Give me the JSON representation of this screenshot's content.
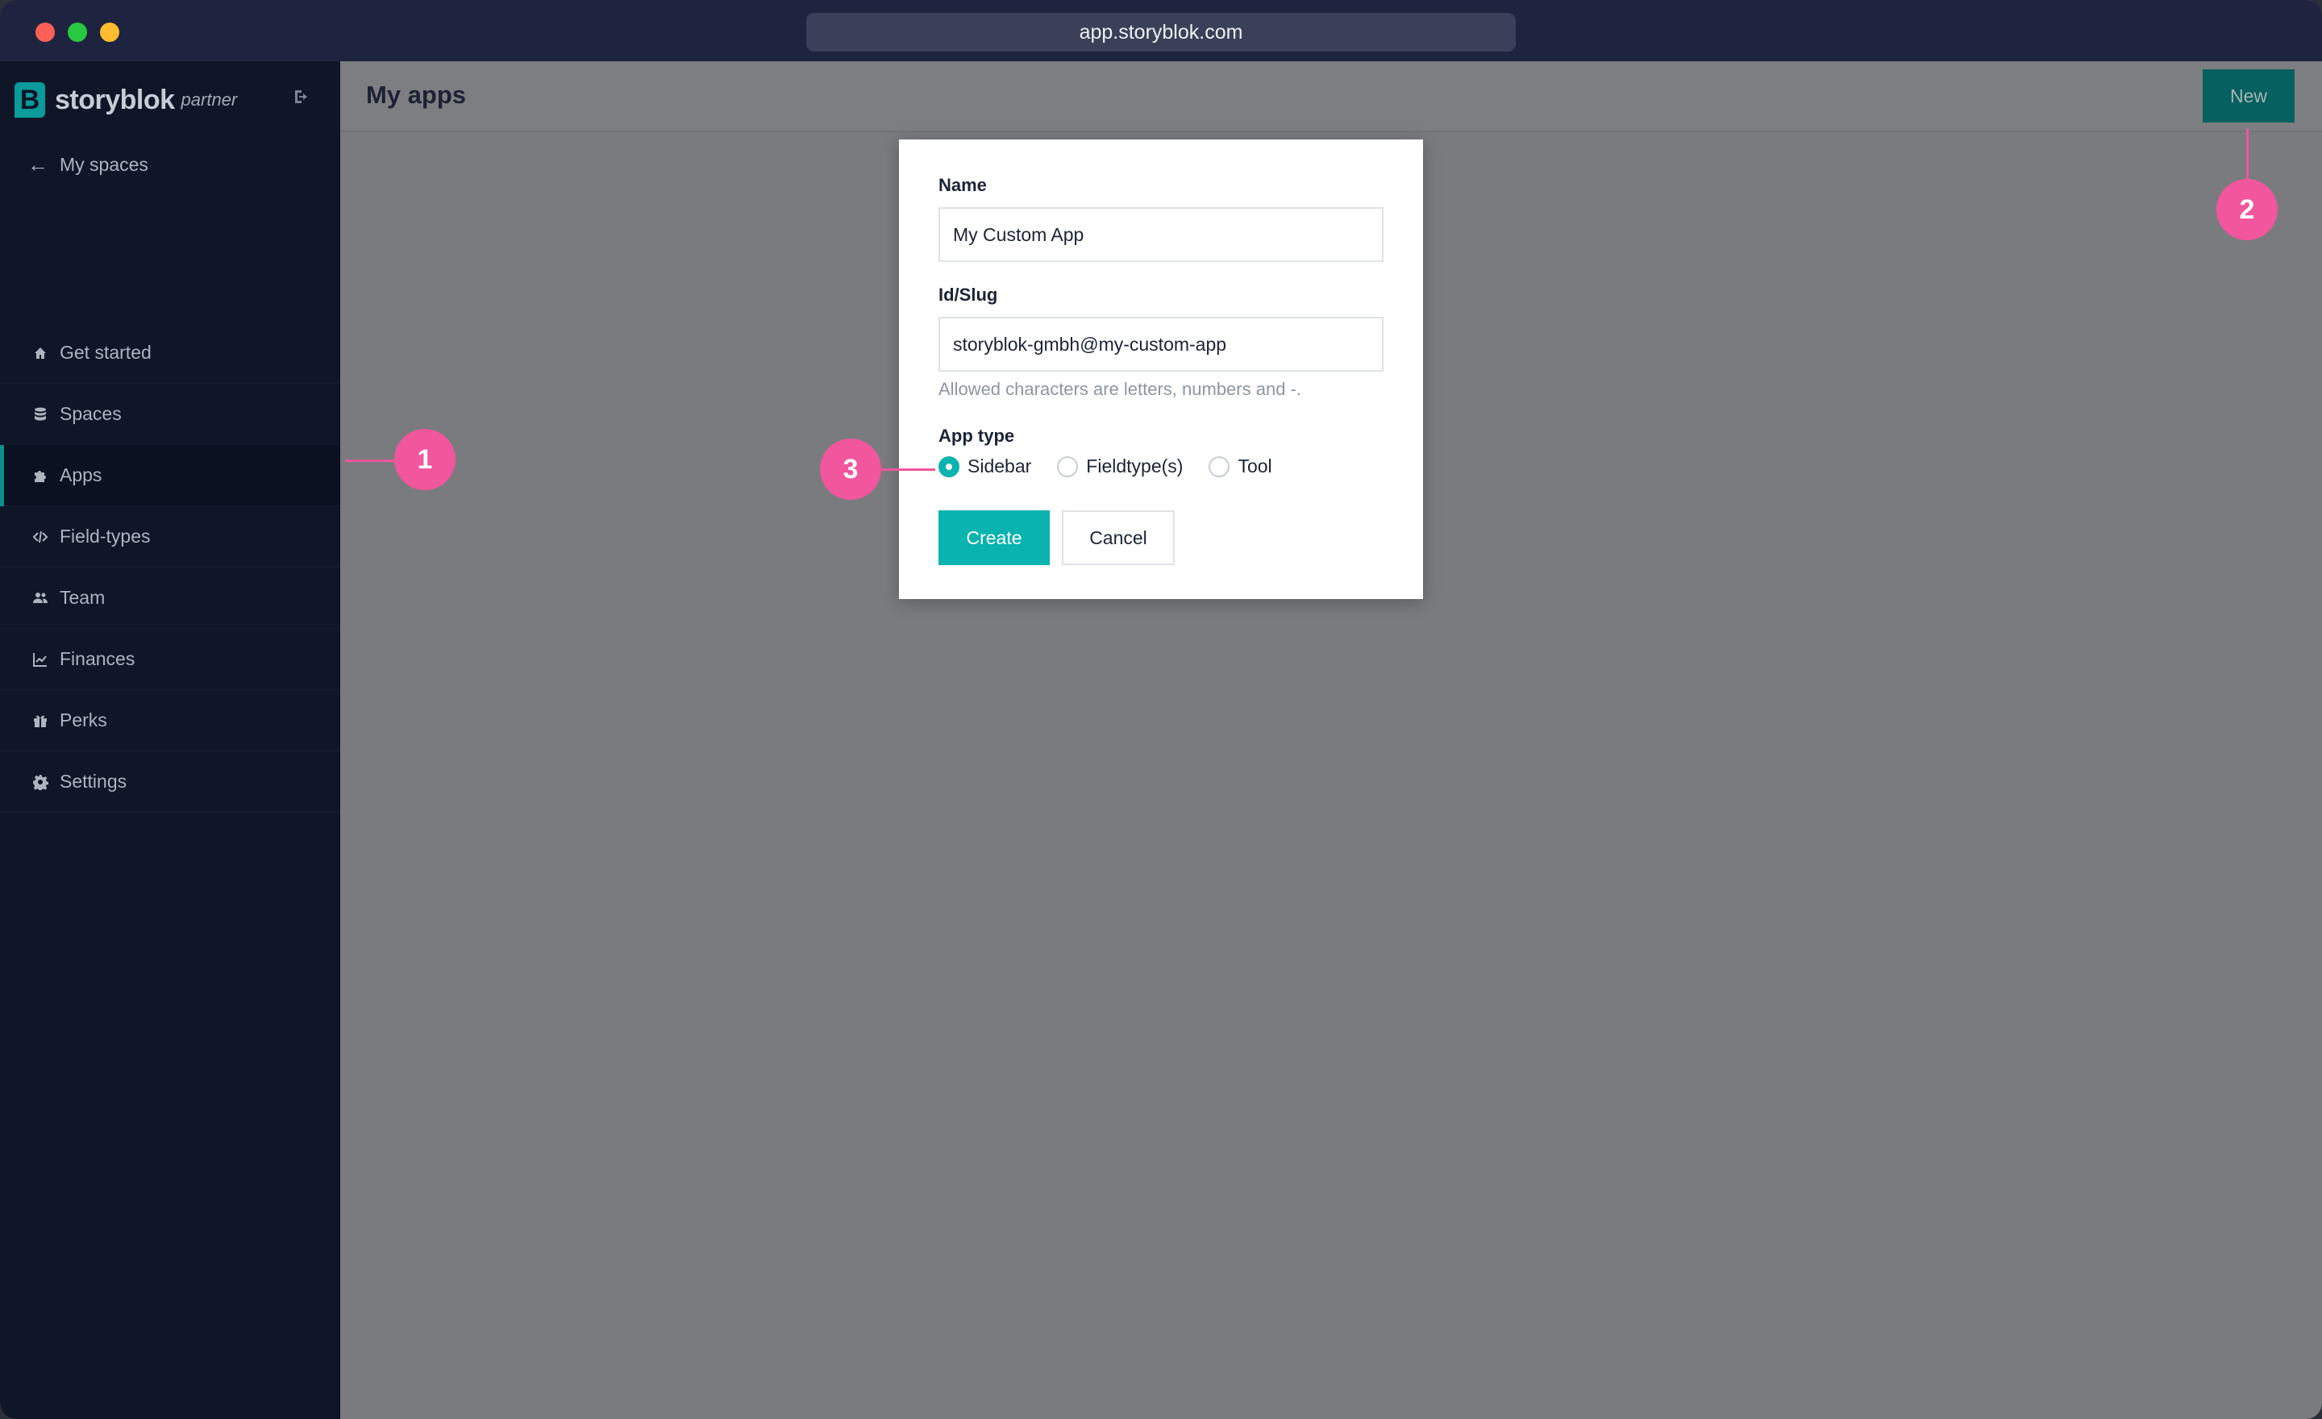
{
  "browser": {
    "url": "app.storyblok.com"
  },
  "sidebar": {
    "brand_letter": "B",
    "brand_name": "storyblok",
    "brand_sub": "partner",
    "back_link": "My spaces",
    "items": [
      {
        "label": "Get started",
        "icon": "home-icon"
      },
      {
        "label": "Spaces",
        "icon": "database-icon"
      },
      {
        "label": "Apps",
        "icon": "puzzle-icon",
        "active": true
      },
      {
        "label": "Field-types",
        "icon": "code-icon"
      },
      {
        "label": "Team",
        "icon": "users-icon"
      },
      {
        "label": "Finances",
        "icon": "chart-line-icon"
      },
      {
        "label": "Perks",
        "icon": "gift-icon"
      },
      {
        "label": "Settings",
        "icon": "gear-icon"
      }
    ]
  },
  "header": {
    "title": "My apps",
    "new_label": "New"
  },
  "modal": {
    "name_label": "Name",
    "name_value": "My Custom App",
    "slug_label": "Id/Slug",
    "slug_value": "storyblok-gmbh@my-custom-app",
    "slug_help": "Allowed characters are letters, numbers and -.",
    "app_type_label": "App type",
    "app_type_options": [
      {
        "label": "Sidebar",
        "selected": true
      },
      {
        "label": "Fieldtype(s)",
        "selected": false
      },
      {
        "label": "Tool",
        "selected": false
      }
    ],
    "create_label": "Create",
    "cancel_label": "Cancel"
  },
  "callouts": [
    "1",
    "2",
    "3"
  ],
  "colors": {
    "accent": "#09b3af",
    "sidebar_bg": "#0f1628",
    "callout": "#f2569c"
  }
}
